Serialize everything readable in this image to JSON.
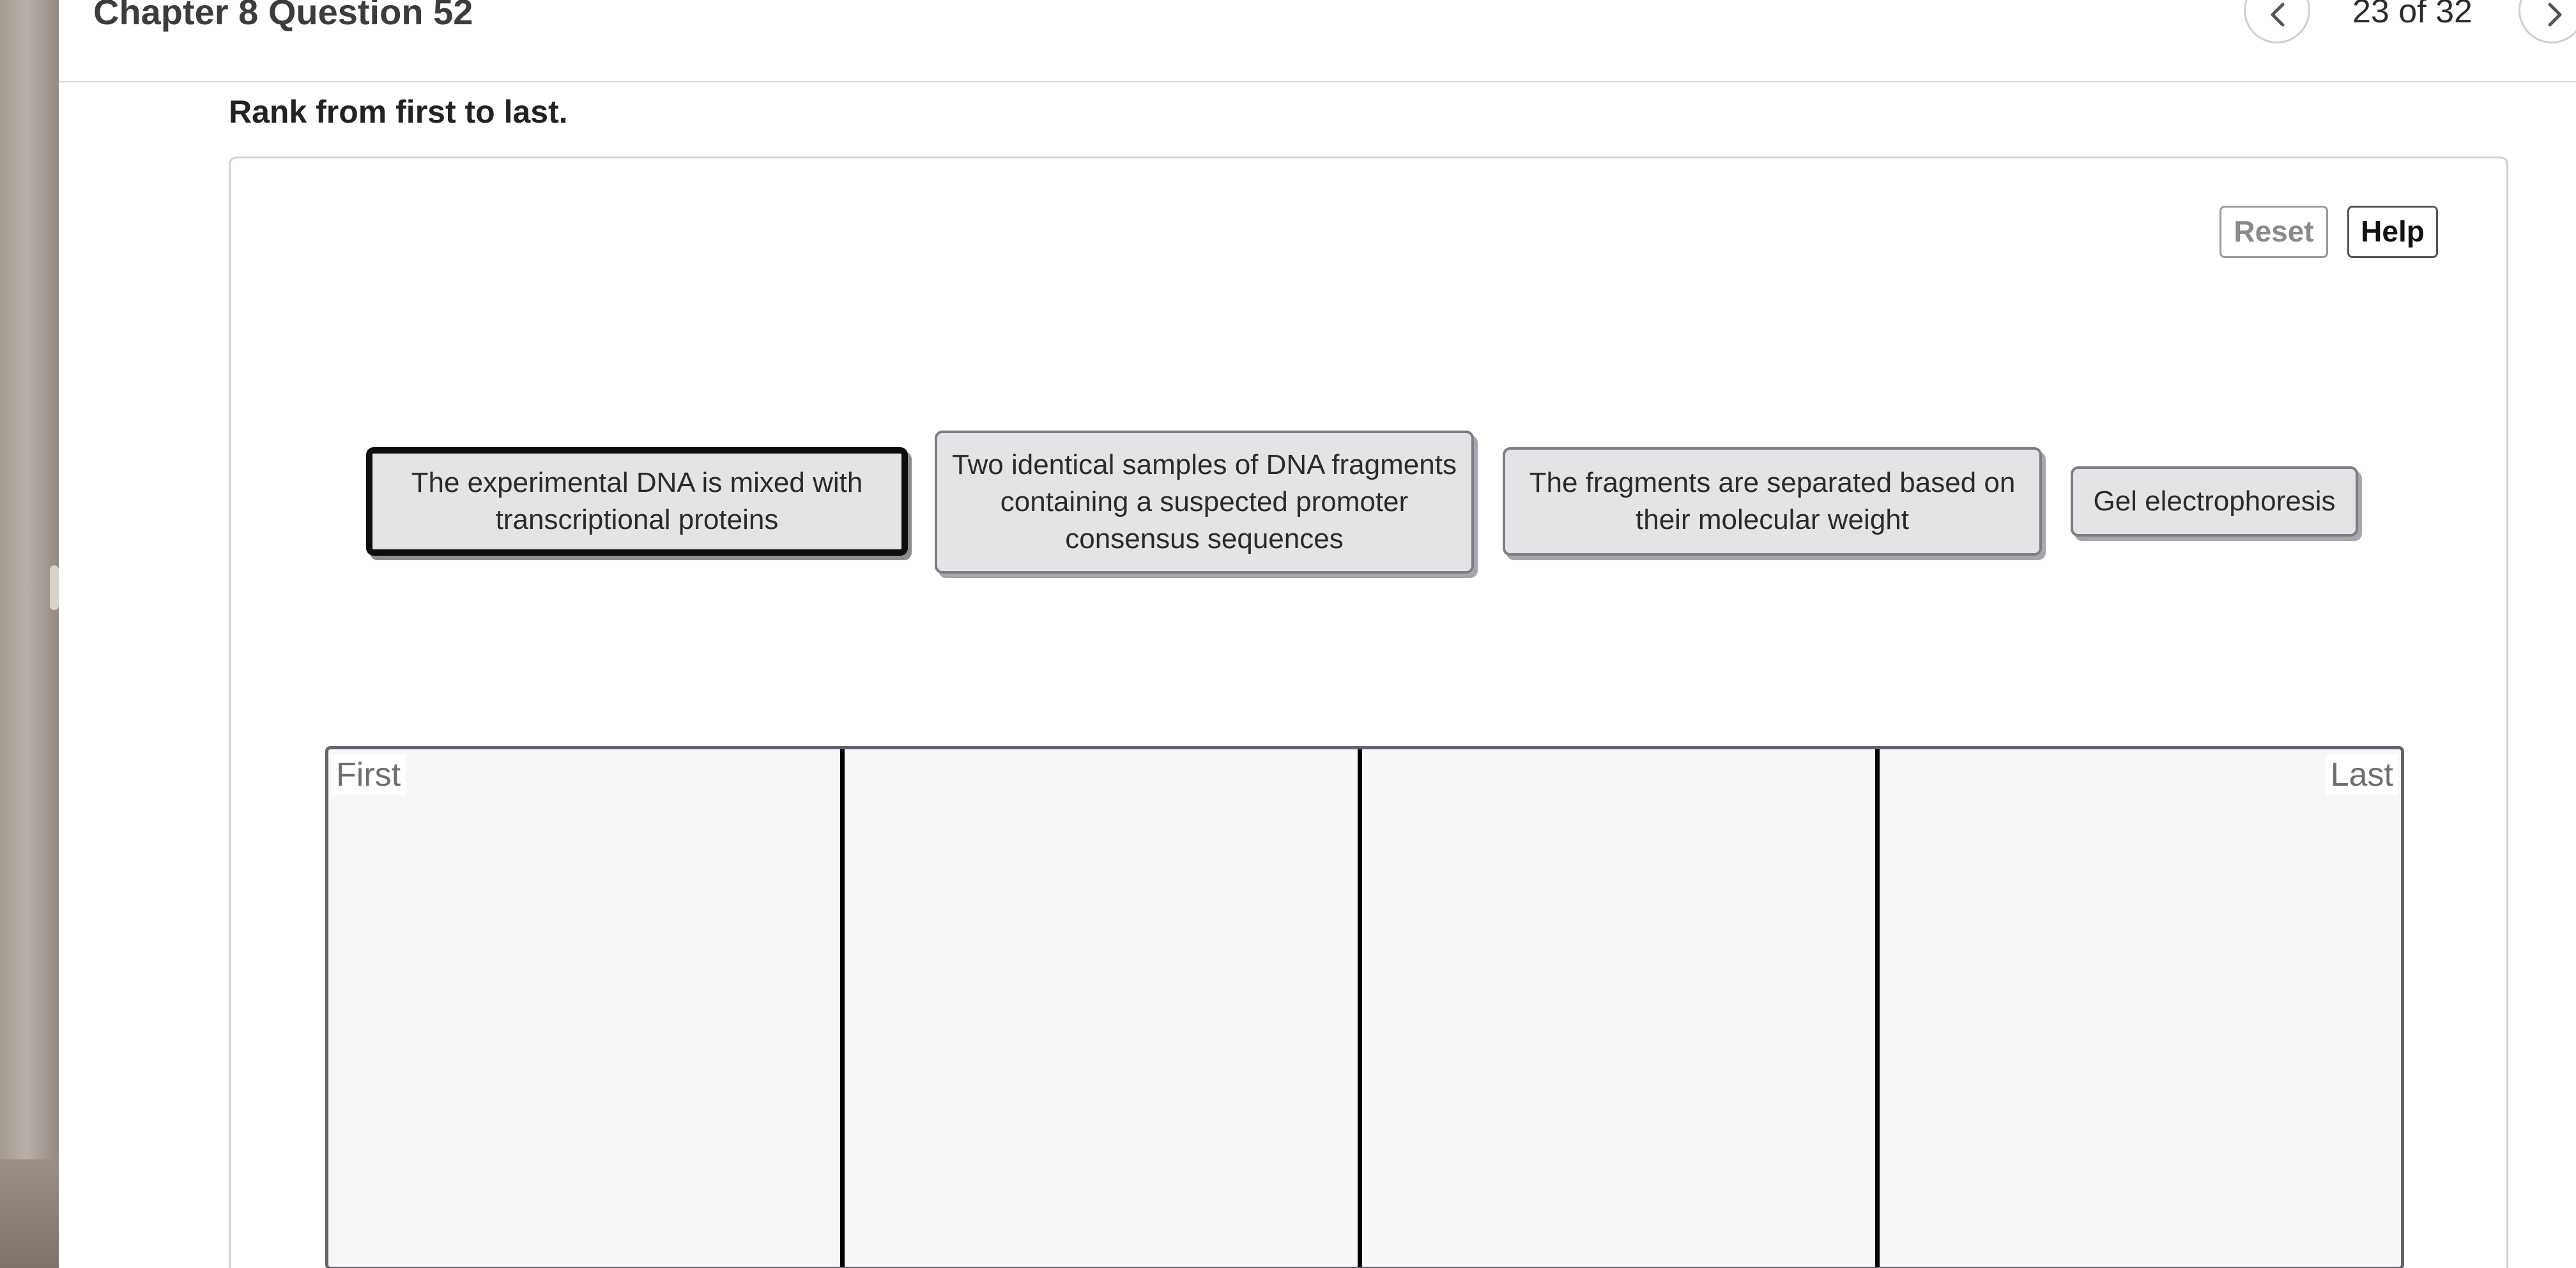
{
  "header": {
    "title": "Chapter 8 Question 52",
    "counter": "23 of 32",
    "prev_icon": "chevron-left-icon",
    "next_icon": "chevron-right-icon"
  },
  "instruction": "Rank from first to last.",
  "toolbar": {
    "reset_label": "Reset",
    "help_label": "Help"
  },
  "items": [
    {
      "text": "The experimental DNA is mixed with transcriptional proteins",
      "selected": true
    },
    {
      "text": "Two identical samples of DNA fragments containing a suspected promoter consensus sequences",
      "selected": false
    },
    {
      "text": "The fragments are separated based on their molecular weight",
      "selected": false
    },
    {
      "text": "Gel electrophoresis",
      "selected": false
    }
  ],
  "ranking": {
    "first_label": "First",
    "last_label": "Last",
    "slots": 4
  },
  "colors": {
    "item_fill": "#e4e4e6",
    "item_border": "#7c7d86",
    "selected_border": "#0d0d0d",
    "rank_area_fill": "#f7f7f7"
  }
}
